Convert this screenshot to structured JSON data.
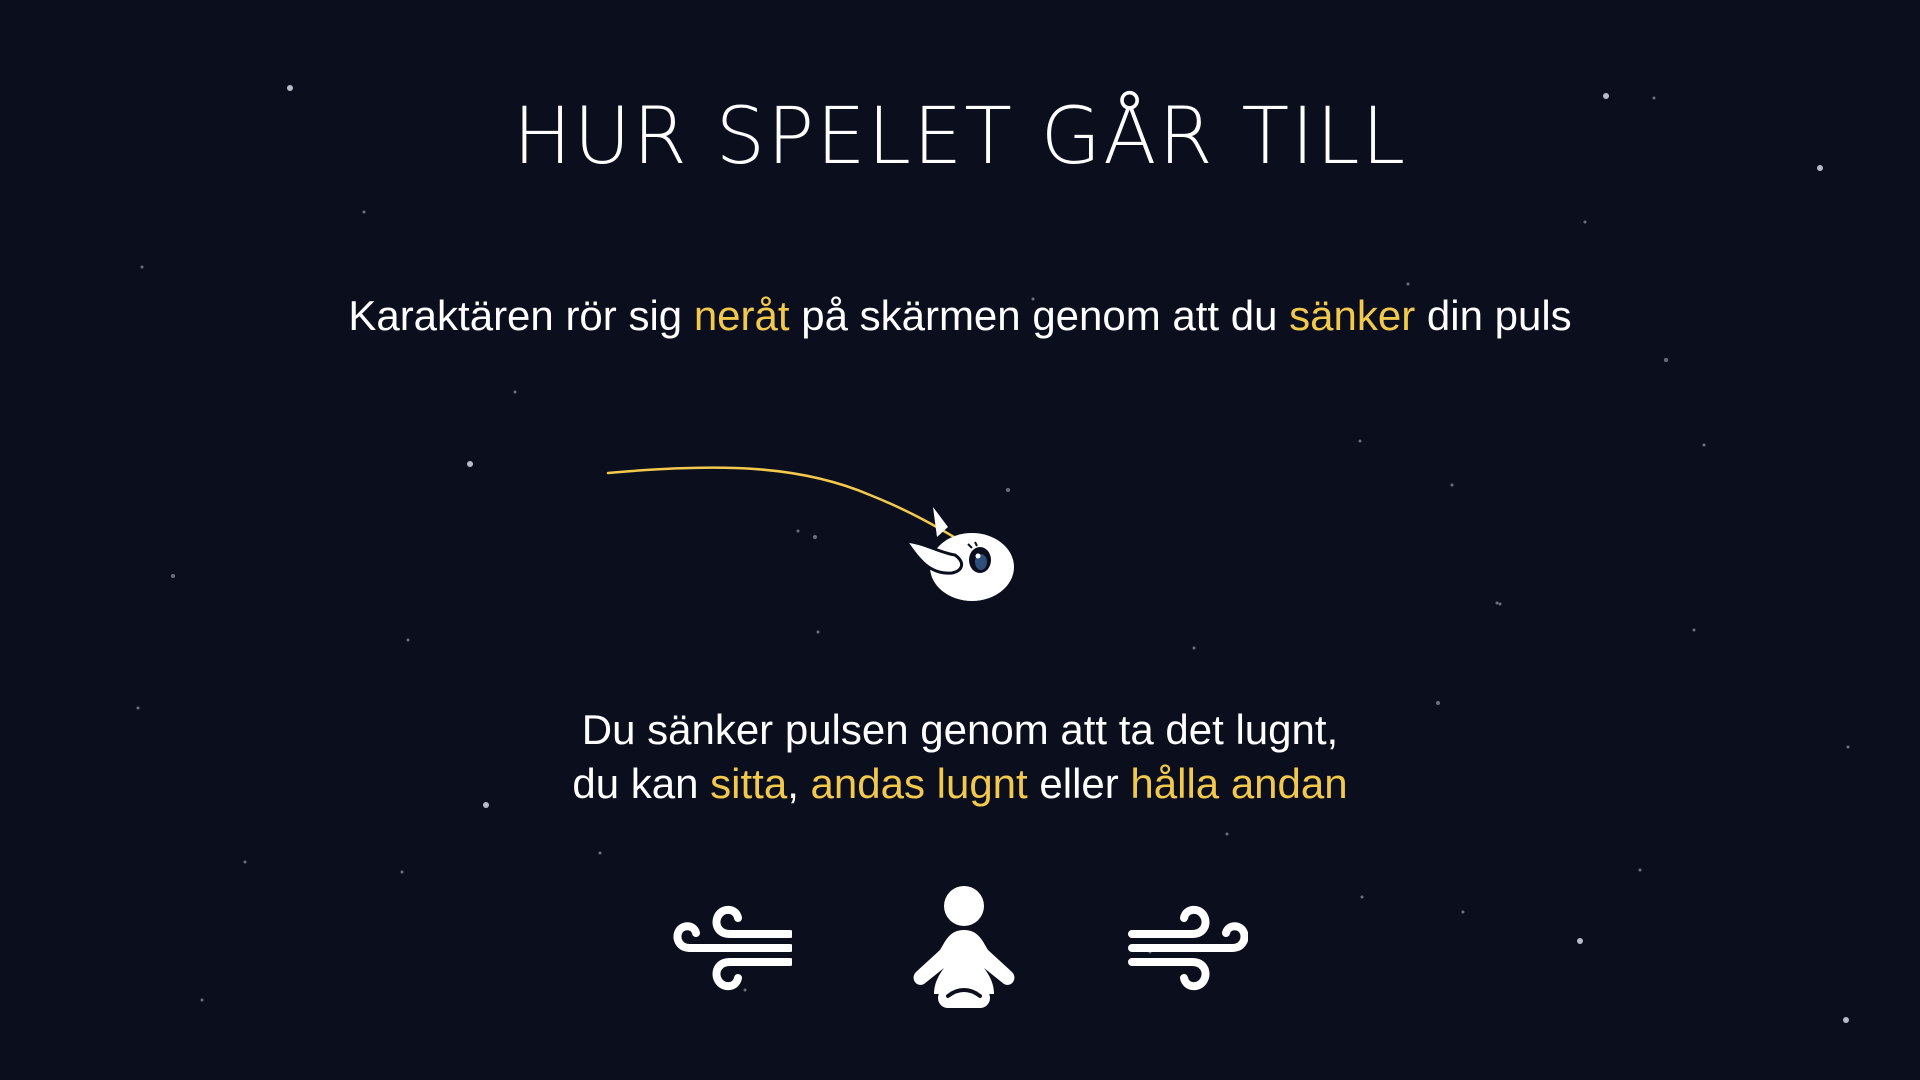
{
  "title": "HUR SPELET GÅR TILL",
  "colors": {
    "background": "#0b0f1d",
    "text": "#ffffff",
    "highlight": "#f2c94c"
  },
  "instruction1": {
    "t1": "Karaktären rör sig ",
    "h1": "neråt",
    "t2": " på skärmen genom att du ",
    "h2": "sänker",
    "t3": " din puls"
  },
  "instruction2": {
    "line1": "Du sänker pulsen genom att ta det lugnt,",
    "t1": "du kan ",
    "h1": "sitta",
    "t2": ", ",
    "h2": "andas lugnt",
    "t3": " eller ",
    "h3": "hålla andan"
  },
  "icons": {
    "character": "bird-character-icon",
    "trail": "trajectory-line",
    "left": "wind-icon",
    "center": "meditation-icon",
    "right": "wind-icon"
  }
}
